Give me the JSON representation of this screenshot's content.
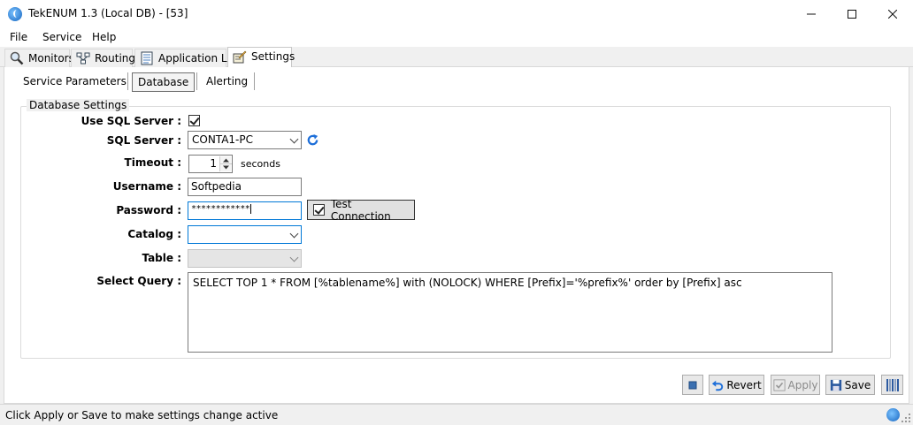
{
  "window": {
    "title": "TekENUM 1.3 (Local DB) - [53]",
    "minimize_glyph": "—",
    "maximize_glyph": "☐",
    "close_glyph": "✕"
  },
  "menu": [
    "File",
    "Service",
    "Help"
  ],
  "tabs": [
    {
      "label": "Monitors",
      "icon": "search-icon"
    },
    {
      "label": "Routing",
      "icon": "routing-icon"
    },
    {
      "label": "Application Log",
      "icon": "log-icon"
    },
    {
      "label": "Settings",
      "icon": "settings-icon",
      "active": true
    }
  ],
  "subtabs": [
    {
      "label": "Service Parameters"
    },
    {
      "label": "Database",
      "active": true
    },
    {
      "label": "Alerting"
    }
  ],
  "group": {
    "title": "Database Settings"
  },
  "form": {
    "use_sql_label": "Use SQL Server :",
    "use_sql_checked": true,
    "sql_server_label": "SQL Server :",
    "sql_server_value": "CONTA1-PC",
    "timeout_label": "Timeout :",
    "timeout_value": "1",
    "timeout_unit": "seconds",
    "username_label": "Username :",
    "username_value": "Softpedia",
    "password_label": "Password :",
    "password_value": "************",
    "test_connection_label": "Test Connection",
    "test_connection_checked": true,
    "catalog_label": "Catalog :",
    "catalog_value": "",
    "table_label": "Table :",
    "table_value": "",
    "select_query_label": "Select Query :",
    "select_query_value": "SELECT TOP 1 * FROM [%tablename%] with (NOLOCK) WHERE [Prefix]='%prefix%' order by [Prefix] asc"
  },
  "buttons": {
    "revert": "Revert",
    "apply": "Apply",
    "save": "Save"
  },
  "status": {
    "text": "Click Apply or Save to make settings change active"
  },
  "colors": {
    "accent": "#0078d7",
    "refresh": "#1e6fd9"
  }
}
